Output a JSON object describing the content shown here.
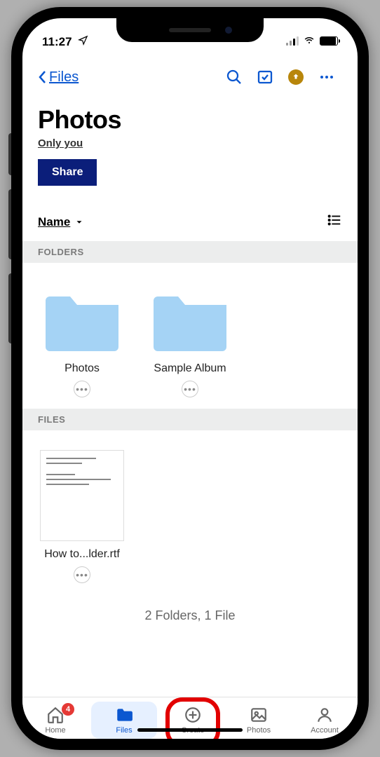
{
  "status": {
    "time": "11:27"
  },
  "topbar": {
    "back_label": "Files"
  },
  "header": {
    "title": "Photos",
    "subtitle": "Only you",
    "share_label": "Share"
  },
  "sort": {
    "label": "Name"
  },
  "sections": {
    "folders_label": "FOLDERS",
    "files_label": "FILES"
  },
  "folders": [
    {
      "name": "Photos"
    },
    {
      "name": "Sample Album"
    }
  ],
  "files": [
    {
      "name": "How to...lder.rtf"
    }
  ],
  "summary": "2 Folders, 1 File",
  "tabs": {
    "home": {
      "label": "Home",
      "badge": "4"
    },
    "files": {
      "label": "Files"
    },
    "create": {
      "label": "Create"
    },
    "photos": {
      "label": "Photos"
    },
    "account": {
      "label": "Account"
    }
  }
}
